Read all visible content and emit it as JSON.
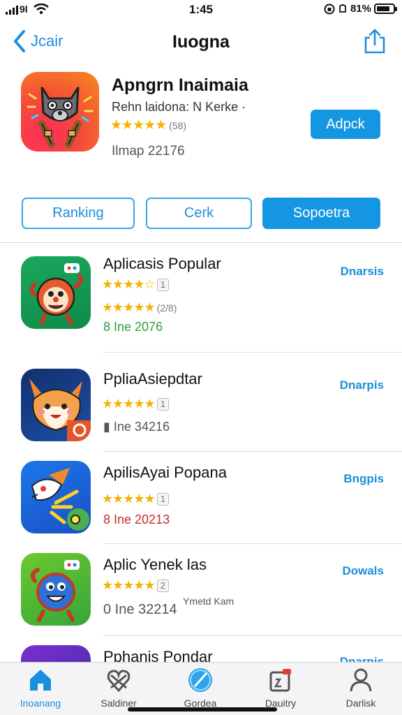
{
  "status": {
    "time": "1:45",
    "carrier": "9l",
    "battery": "81%"
  },
  "nav": {
    "back_label": "Jcair",
    "title": "Iuogna"
  },
  "hero": {
    "name": "Apngrn Inaimaia",
    "subtitle": "Rehn laidona: N Kerke ·",
    "stars": "★★★★★",
    "rating_count": "(58)",
    "meta": "Ilmap 22176",
    "button": "Adpck"
  },
  "segments": [
    "Ranking",
    "Cerk",
    "Sopoetra"
  ],
  "list": [
    {
      "name": "Aplicasis Popular",
      "stars": "★★★★☆",
      "badge": "1",
      "stars2": "★★★★★",
      "count2": "(2/8)",
      "meta": "8 Ine 2076",
      "meta_color": "#2e9e3e",
      "action": "Dnarsis"
    },
    {
      "name": "PpliaAsiepdtar",
      "stars": "★★★★★",
      "badge": "1",
      "meta": "▮ Ine 34216",
      "meta_color": "#555555",
      "action": "Dnarpis"
    },
    {
      "name": "ApilisAyai Popana",
      "stars": "★★★★★",
      "badge": "1",
      "meta": "8 Ine 20213",
      "meta_color": "#c62b2b",
      "action": "Bngpis"
    },
    {
      "name": "Aplic Yenek las",
      "stars": "★★★★★",
      "badge": "2",
      "meta": "0 Ine 32214",
      "meta_color": "#555555",
      "extra": "Ymetd Kam",
      "action": "Dowals"
    },
    {
      "name": "Pphanis Pondar",
      "action": "Dnarpis"
    }
  ],
  "tabs": [
    {
      "label": "Inoanang",
      "icon": "home-icon"
    },
    {
      "label": "Saldiner",
      "icon": "heart-icon"
    },
    {
      "label": "Gordea",
      "icon": "compass-icon"
    },
    {
      "label": "Dauitry",
      "icon": "calendar-icon"
    },
    {
      "label": "Darlisk",
      "icon": "person-icon"
    }
  ],
  "colors": {
    "accent": "#1596e2",
    "star": "#f2b400"
  }
}
